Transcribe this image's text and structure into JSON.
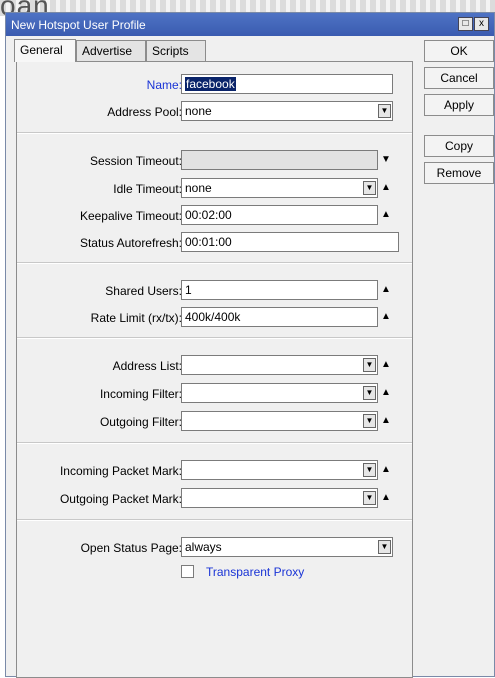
{
  "background": {
    "partial_text": "oan"
  },
  "window": {
    "title": "New Hotspot User Profile",
    "controls": {
      "maximize": "□",
      "close": "x"
    }
  },
  "tabs": [
    {
      "label": "General",
      "active": true
    },
    {
      "label": "Advertise",
      "active": false
    },
    {
      "label": "Scripts",
      "active": false
    }
  ],
  "buttons": {
    "ok": "OK",
    "cancel": "Cancel",
    "apply": "Apply",
    "copy": "Copy",
    "remove": "Remove"
  },
  "fields": {
    "name": {
      "label": "Name:",
      "value": "facebook"
    },
    "address_pool": {
      "label": "Address Pool:",
      "value": "none"
    },
    "session_timeout": {
      "label": "Session Timeout:",
      "value": ""
    },
    "idle_timeout": {
      "label": "Idle Timeout:",
      "value": "none"
    },
    "keepalive_timeout": {
      "label": "Keepalive Timeout:",
      "value": "00:02:00"
    },
    "status_autorefresh": {
      "label": "Status Autorefresh:",
      "value": "00:01:00"
    },
    "shared_users": {
      "label": "Shared Users:",
      "value": "1"
    },
    "rate_limit": {
      "label": "Rate Limit (rx/tx):",
      "value": "400k/400k"
    },
    "address_list": {
      "label": "Address List:",
      "value": ""
    },
    "incoming_filter": {
      "label": "Incoming Filter:",
      "value": ""
    },
    "outgoing_filter": {
      "label": "Outgoing Filter:",
      "value": ""
    },
    "incoming_packet_mark": {
      "label": "Incoming Packet Mark:",
      "value": ""
    },
    "outgoing_packet_mark": {
      "label": "Outgoing Packet Mark:",
      "value": ""
    },
    "open_status_page": {
      "label": "Open Status Page:",
      "value": "always"
    }
  },
  "transparent_proxy": {
    "label": "Transparent Proxy",
    "checked": false
  },
  "icons": {
    "dropdown": "▼",
    "expand_up": "▲",
    "expand_down": "▼"
  }
}
